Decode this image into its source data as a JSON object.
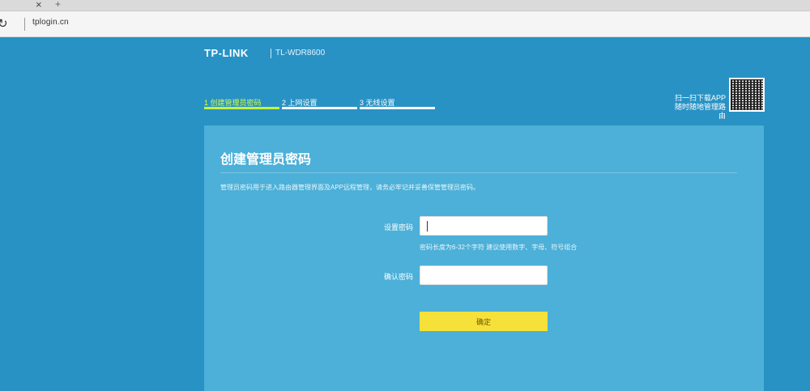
{
  "browser": {
    "tab_close": "×",
    "tab_new": "+",
    "reload": "↻",
    "url": "tplogin.cn"
  },
  "header": {
    "logo": "TP-LINK",
    "model": "TL-WDR8600"
  },
  "steps": [
    {
      "label": "1 创建管理员密码",
      "active": true
    },
    {
      "label": "2 上网设置",
      "active": false
    },
    {
      "label": "3 无线设置",
      "active": false
    }
  ],
  "qr": {
    "text": "扫一扫下载APP\n随时随地管理路由"
  },
  "card": {
    "title": "创建管理员密码",
    "description": "管理员密码用于进入路由器管理界面及APP远程管理，请务必牢记并妥善保管管理员密码。"
  },
  "form": {
    "password_label": "设置密码",
    "password_value": "",
    "hint": "密码长度为6-32个字符   建议使用数字、字母、符号组合",
    "confirm_label": "确认密码",
    "confirm_value": "",
    "confirm_button": "确定"
  }
}
